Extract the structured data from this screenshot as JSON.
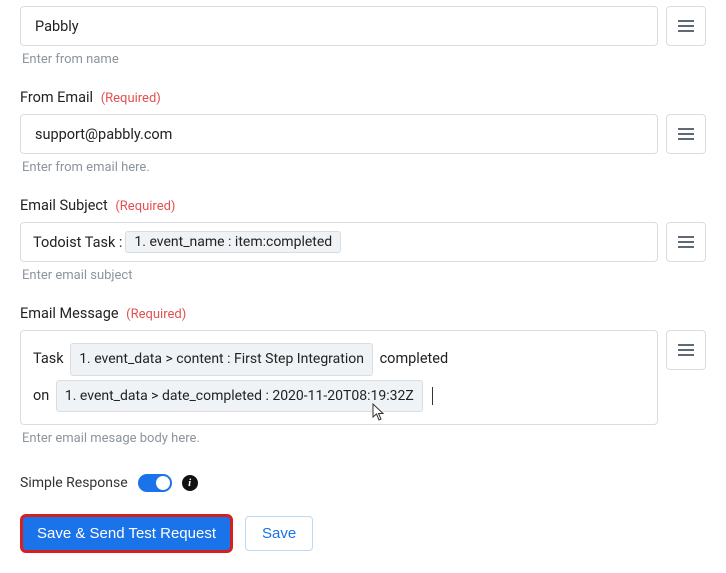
{
  "fromName": {
    "value": "Pabbly",
    "hint": "Enter from name"
  },
  "fromEmail": {
    "label": "From Email",
    "required": "(Required)",
    "value": "support@pabbly.com",
    "hint": "Enter from email here."
  },
  "emailSubject": {
    "label": "Email Subject",
    "required": "(Required)",
    "prefix": "Todoist Task :",
    "chip1": "1. event_name : item:completed",
    "hint": "Enter email subject"
  },
  "emailMessage": {
    "label": "Email Message",
    "required": "(Required)",
    "t1": "Task",
    "chip1": "1. event_data > content : First Step Integration",
    "t2": "completed",
    "t3": "on",
    "chip2": "1. event_data > date_completed : 2020-11-20T08:19:32Z",
    "hint": "Enter email mesage body here."
  },
  "simpleResponse": {
    "label": "Simple Response",
    "on": true
  },
  "buttons": {
    "primary": "Save & Send Test Request",
    "secondary": "Save"
  }
}
